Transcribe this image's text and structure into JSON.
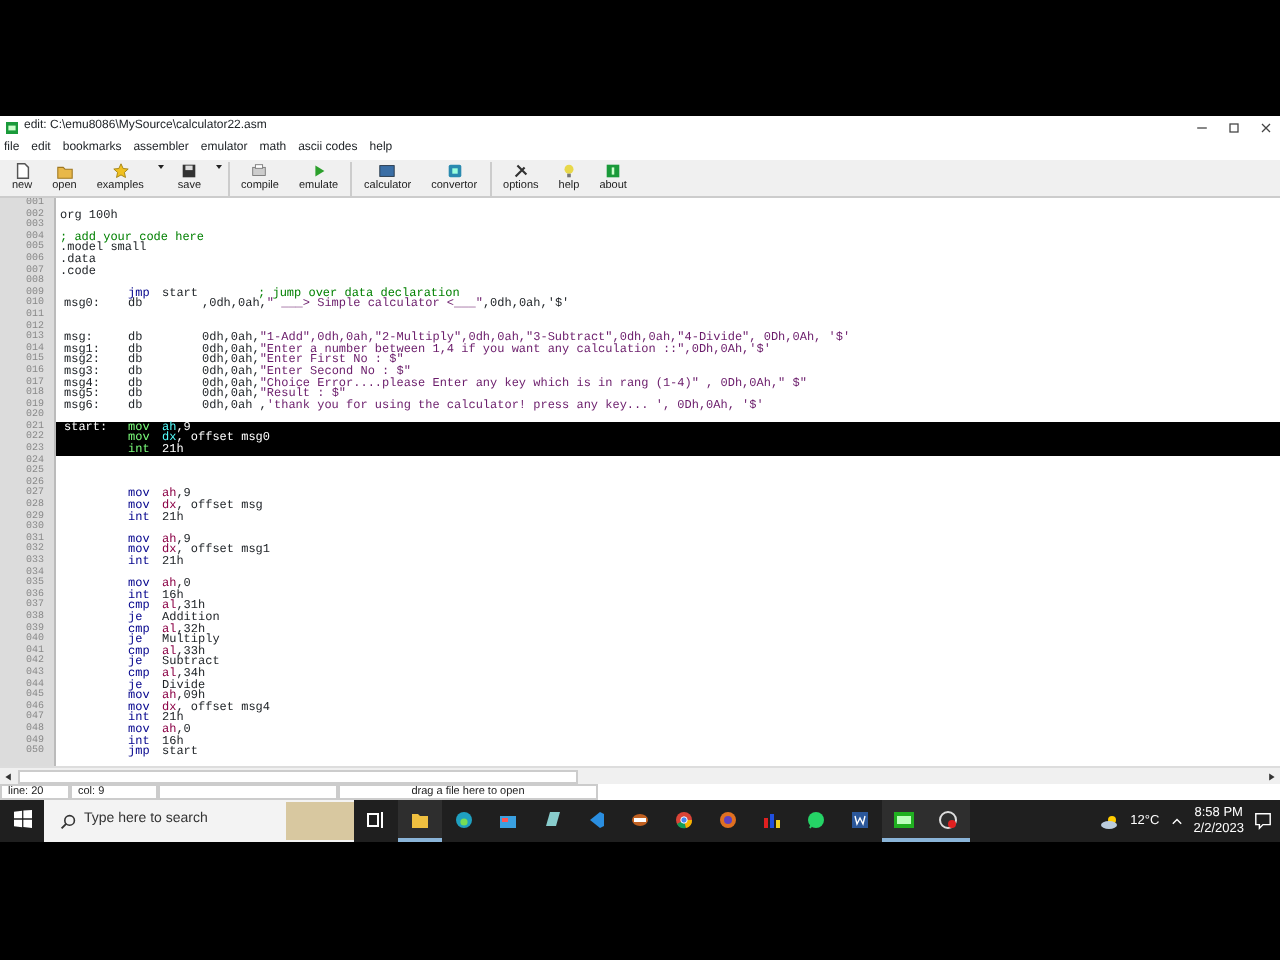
{
  "window": {
    "title": "edit: C:\\emu8086\\MySource\\calculator22.asm"
  },
  "menu": [
    "file",
    "edit",
    "bookmarks",
    "assembler",
    "emulator",
    "math",
    "ascii codes",
    "help"
  ],
  "toolbar": [
    {
      "label": "new",
      "kind": "file",
      "dropdown": false
    },
    {
      "label": "open",
      "kind": "folder",
      "dropdown": false
    },
    {
      "label": "examples",
      "kind": "star",
      "dropdown": true
    },
    {
      "label": "save",
      "kind": "disk",
      "dropdown": true
    },
    {
      "label": "compile",
      "kind": "compile",
      "dropdown": false
    },
    {
      "label": "emulate",
      "kind": "play",
      "dropdown": false
    },
    {
      "label": "calculator",
      "kind": "screen",
      "dropdown": false
    },
    {
      "label": "convertor",
      "kind": "chip",
      "dropdown": false
    },
    {
      "label": "options",
      "kind": "tools",
      "dropdown": false
    },
    {
      "label": "help",
      "kind": "bulb",
      "dropdown": false
    },
    {
      "label": "about",
      "kind": "box",
      "dropdown": false
    }
  ],
  "editor": {
    "lines": [
      {
        "num": "001",
        "kind": "blank",
        "selected": false
      },
      {
        "num": "002",
        "kind": "text",
        "text": "org 100h",
        "selected": false
      },
      {
        "num": "003",
        "kind": "blank",
        "selected": false
      },
      {
        "num": "004",
        "kind": "comment",
        "text": "; add your code here",
        "selected": false
      },
      {
        "num": "005",
        "kind": "text",
        "text": ".model small",
        "selected": false
      },
      {
        "num": "006",
        "kind": "text",
        "text": ".data",
        "selected": false
      },
      {
        "num": "007",
        "kind": "text",
        "text": ".code",
        "selected": false
      },
      {
        "num": "008",
        "kind": "blank",
        "selected": false
      },
      {
        "num": "009",
        "kind": "code",
        "op": "jmp",
        "args": [
          {
            "kind": "plain",
            "text": "start"
          }
        ],
        "comment": "; jump over data declaration",
        "selected": false
      },
      {
        "num": "010",
        "kind": "data",
        "label": "msg0:",
        "op": "db",
        "args": [
          {
            "kind": "plain",
            "text": ",0dh,0ah,"
          },
          {
            "kind": "string",
            "text": "\" ___> Simple calculator <___\""
          },
          {
            "kind": "plain",
            "text": ",0dh,0ah,'$'"
          }
        ],
        "selected": false
      },
      {
        "num": "011",
        "kind": "blank",
        "selected": false
      },
      {
        "num": "012",
        "kind": "blank",
        "selected": false
      },
      {
        "num": "013",
        "kind": "data",
        "label": "msg:",
        "op": "db",
        "args": [
          {
            "kind": "plain",
            "text": "0dh,0ah,"
          },
          {
            "kind": "string",
            "text": "\"1-Add\",0dh,0ah,\"2-Multiply\",0dh,0ah,\"3-Subtract\",0dh,0ah,\"4-Divide\", 0Dh,0Ah, '$'"
          }
        ],
        "selected": false
      },
      {
        "num": "014",
        "kind": "data",
        "label": "msg1:",
        "op": "db",
        "args": [
          {
            "kind": "plain",
            "text": "0dh,0ah,"
          },
          {
            "kind": "string",
            "text": "\"Enter a number between 1,4 if you want any calculation ::\",0Dh,0Ah,'$'"
          }
        ],
        "selected": false
      },
      {
        "num": "015",
        "kind": "data",
        "label": "msg2:",
        "op": "db",
        "args": [
          {
            "kind": "plain",
            "text": "0dh,0ah,"
          },
          {
            "kind": "string",
            "text": "\"Enter First No : $\""
          }
        ],
        "selected": false
      },
      {
        "num": "016",
        "kind": "data",
        "label": "msg3:",
        "op": "db",
        "args": [
          {
            "kind": "plain",
            "text": "0dh,0ah,"
          },
          {
            "kind": "string",
            "text": "\"Enter Second No : $\""
          }
        ],
        "selected": false
      },
      {
        "num": "017",
        "kind": "data",
        "label": "msg4:",
        "op": "db",
        "args": [
          {
            "kind": "plain",
            "text": "0dh,0ah,"
          },
          {
            "kind": "string",
            "text": "\"Choice Error....please Enter any key which is in rang (1-4)\" , 0Dh,0Ah,\" $\""
          }
        ],
        "selected": false
      },
      {
        "num": "018",
        "kind": "data",
        "label": "msg5:",
        "op": "db",
        "args": [
          {
            "kind": "plain",
            "text": "0dh,0ah,"
          },
          {
            "kind": "string",
            "text": "\"Result : $\""
          }
        ],
        "selected": false
      },
      {
        "num": "019",
        "kind": "data",
        "label": "msg6:",
        "op": "db",
        "args": [
          {
            "kind": "plain",
            "text": "0dh,0ah ,"
          },
          {
            "kind": "string",
            "text": "'thank you for using the calculator! press any key... ', 0Dh,0Ah, '$'"
          }
        ],
        "selected": false
      },
      {
        "num": "020",
        "kind": "blank",
        "selected": false
      },
      {
        "num": "021",
        "kind": "code",
        "label": "start:",
        "op": "mov",
        "args": [
          {
            "kind": "reg",
            "text": "ah"
          },
          {
            "kind": "plain",
            "text": ",9"
          }
        ],
        "selected": true
      },
      {
        "num": "022",
        "kind": "code",
        "op": "mov",
        "args": [
          {
            "kind": "reg",
            "text": "dx"
          },
          {
            "kind": "plain",
            "text": ", offset msg0"
          }
        ],
        "selected": true
      },
      {
        "num": "023",
        "kind": "code",
        "op": "int",
        "args": [
          {
            "kind": "plain",
            "text": "21h"
          }
        ],
        "selected": true
      },
      {
        "num": "024",
        "kind": "blank",
        "selected": false
      },
      {
        "num": "025",
        "kind": "blank",
        "selected": false
      },
      {
        "num": "026",
        "kind": "blank",
        "selected": false
      },
      {
        "num": "027",
        "kind": "code",
        "op": "mov",
        "args": [
          {
            "kind": "reg",
            "text": "ah"
          },
          {
            "kind": "plain",
            "text": ",9"
          }
        ],
        "selected": false
      },
      {
        "num": "028",
        "kind": "code",
        "op": "mov",
        "args": [
          {
            "kind": "reg",
            "text": "dx"
          },
          {
            "kind": "plain",
            "text": ", offset msg"
          }
        ],
        "selected": false
      },
      {
        "num": "029",
        "kind": "code",
        "op": "int",
        "args": [
          {
            "kind": "plain",
            "text": "21h"
          }
        ],
        "selected": false
      },
      {
        "num": "030",
        "kind": "blank",
        "selected": false
      },
      {
        "num": "031",
        "kind": "code",
        "op": "mov",
        "args": [
          {
            "kind": "reg",
            "text": "ah"
          },
          {
            "kind": "plain",
            "text": ",9"
          }
        ],
        "selected": false
      },
      {
        "num": "032",
        "kind": "code",
        "op": "mov",
        "args": [
          {
            "kind": "reg",
            "text": "dx"
          },
          {
            "kind": "plain",
            "text": ", offset msg1"
          }
        ],
        "selected": false
      },
      {
        "num": "033",
        "kind": "code",
        "op": "int",
        "args": [
          {
            "kind": "plain",
            "text": "21h"
          }
        ],
        "selected": false
      },
      {
        "num": "034",
        "kind": "blank",
        "selected": false
      },
      {
        "num": "035",
        "kind": "code",
        "op": "mov",
        "args": [
          {
            "kind": "reg",
            "text": "ah"
          },
          {
            "kind": "plain",
            "text": ",0"
          }
        ],
        "selected": false
      },
      {
        "num": "036",
        "kind": "code",
        "op": "int",
        "args": [
          {
            "kind": "plain",
            "text": "16h"
          }
        ],
        "selected": false
      },
      {
        "num": "037",
        "kind": "code",
        "op": "cmp",
        "args": [
          {
            "kind": "reg",
            "text": "al"
          },
          {
            "kind": "plain",
            "text": ",31h"
          }
        ],
        "selected": false
      },
      {
        "num": "038",
        "kind": "code",
        "op": "je",
        "args": [
          {
            "kind": "plain",
            "text": "Addition"
          }
        ],
        "selected": false
      },
      {
        "num": "039",
        "kind": "code",
        "op": "cmp",
        "args": [
          {
            "kind": "reg",
            "text": "al"
          },
          {
            "kind": "plain",
            "text": ",32h"
          }
        ],
        "selected": false
      },
      {
        "num": "040",
        "kind": "code",
        "op": "je",
        "args": [
          {
            "kind": "plain",
            "text": "Multiply"
          }
        ],
        "selected": false
      },
      {
        "num": "041",
        "kind": "code",
        "op": "cmp",
        "args": [
          {
            "kind": "reg",
            "text": "al"
          },
          {
            "kind": "plain",
            "text": ",33h"
          }
        ],
        "selected": false
      },
      {
        "num": "042",
        "kind": "code",
        "op": "je",
        "args": [
          {
            "kind": "plain",
            "text": "Subtract"
          }
        ],
        "selected": false
      },
      {
        "num": "043",
        "kind": "code",
        "op": "cmp",
        "args": [
          {
            "kind": "reg",
            "text": "al"
          },
          {
            "kind": "plain",
            "text": ",34h"
          }
        ],
        "selected": false
      },
      {
        "num": "044",
        "kind": "code",
        "op": "je",
        "args": [
          {
            "kind": "plain",
            "text": "Divide"
          }
        ],
        "selected": false
      },
      {
        "num": "045",
        "kind": "code",
        "op": "mov",
        "args": [
          {
            "kind": "reg",
            "text": "ah"
          },
          {
            "kind": "plain",
            "text": ",09h"
          }
        ],
        "selected": false
      },
      {
        "num": "046",
        "kind": "code",
        "op": "mov",
        "args": [
          {
            "kind": "reg",
            "text": "dx"
          },
          {
            "kind": "plain",
            "text": ", offset msg4"
          }
        ],
        "selected": false
      },
      {
        "num": "047",
        "kind": "code",
        "op": "int",
        "args": [
          {
            "kind": "plain",
            "text": "21h"
          }
        ],
        "selected": false
      },
      {
        "num": "048",
        "kind": "code",
        "op": "mov",
        "args": [
          {
            "kind": "reg",
            "text": "ah"
          },
          {
            "kind": "plain",
            "text": ",0"
          }
        ],
        "selected": false
      },
      {
        "num": "049",
        "kind": "code",
        "op": "int",
        "args": [
          {
            "kind": "plain",
            "text": "16h"
          }
        ],
        "selected": false
      },
      {
        "num": "050",
        "kind": "code",
        "op": "jmp",
        "args": [
          {
            "kind": "plain",
            "text": "start"
          }
        ],
        "selected": false
      }
    ]
  },
  "status_bar": {
    "line": "line: 20",
    "col": "col: 9",
    "hint": "drag a file here to open"
  },
  "taskbar": {
    "search": {
      "placeholder": "Type here to search"
    },
    "apps": [
      {
        "kind": "taskview",
        "open": false
      },
      {
        "kind": "folder",
        "open": true
      },
      {
        "kind": "edge",
        "open": false
      },
      {
        "kind": "store",
        "open": false
      },
      {
        "kind": "notes",
        "open": false
      },
      {
        "kind": "code",
        "open": false
      },
      {
        "kind": "ring",
        "open": false
      },
      {
        "kind": "chrome",
        "open": false
      },
      {
        "kind": "browser",
        "open": false
      },
      {
        "kind": "chart",
        "open": false
      },
      {
        "kind": "chat",
        "open": false
      },
      {
        "kind": "word",
        "open": false
      },
      {
        "kind": "emu",
        "open": true
      },
      {
        "kind": "record",
        "open": true
      }
    ],
    "weather": "12°C",
    "time": "8:58 PM",
    "date": "2/2/2023"
  }
}
